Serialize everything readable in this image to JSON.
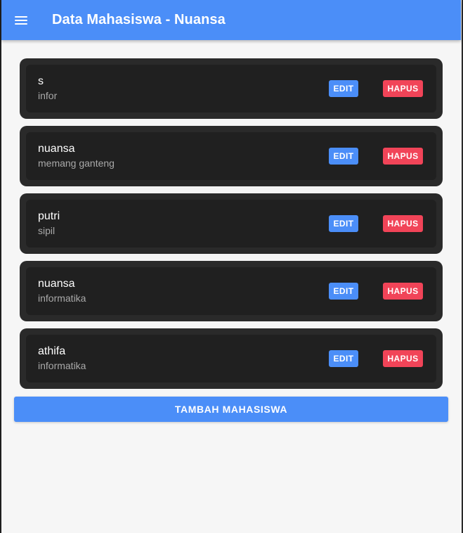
{
  "header": {
    "menu_icon": "hamburger-menu-icon",
    "title": "Data Mahasiswa - Nuansa"
  },
  "students": [
    {
      "name": "s",
      "detail": "infor",
      "edit_label": "EDIT",
      "delete_label": "HAPUS"
    },
    {
      "name": "nuansa",
      "detail": "memang ganteng",
      "edit_label": "EDIT",
      "delete_label": "HAPUS"
    },
    {
      "name": "putri",
      "detail": "sipil",
      "edit_label": "EDIT",
      "delete_label": "HAPUS"
    },
    {
      "name": "nuansa",
      "detail": "informatika",
      "edit_label": "EDIT",
      "delete_label": "HAPUS"
    },
    {
      "name": "athifa",
      "detail": "informatika",
      "edit_label": "EDIT",
      "delete_label": "HAPUS"
    }
  ],
  "actions": {
    "add_label": "TAMBAH MAHASISWA"
  },
  "colors": {
    "primary": "#4b8ef8",
    "danger": "#f14458",
    "card": "#2a2a2a",
    "card_inner": "#202020",
    "background": "#f6f6f6"
  }
}
